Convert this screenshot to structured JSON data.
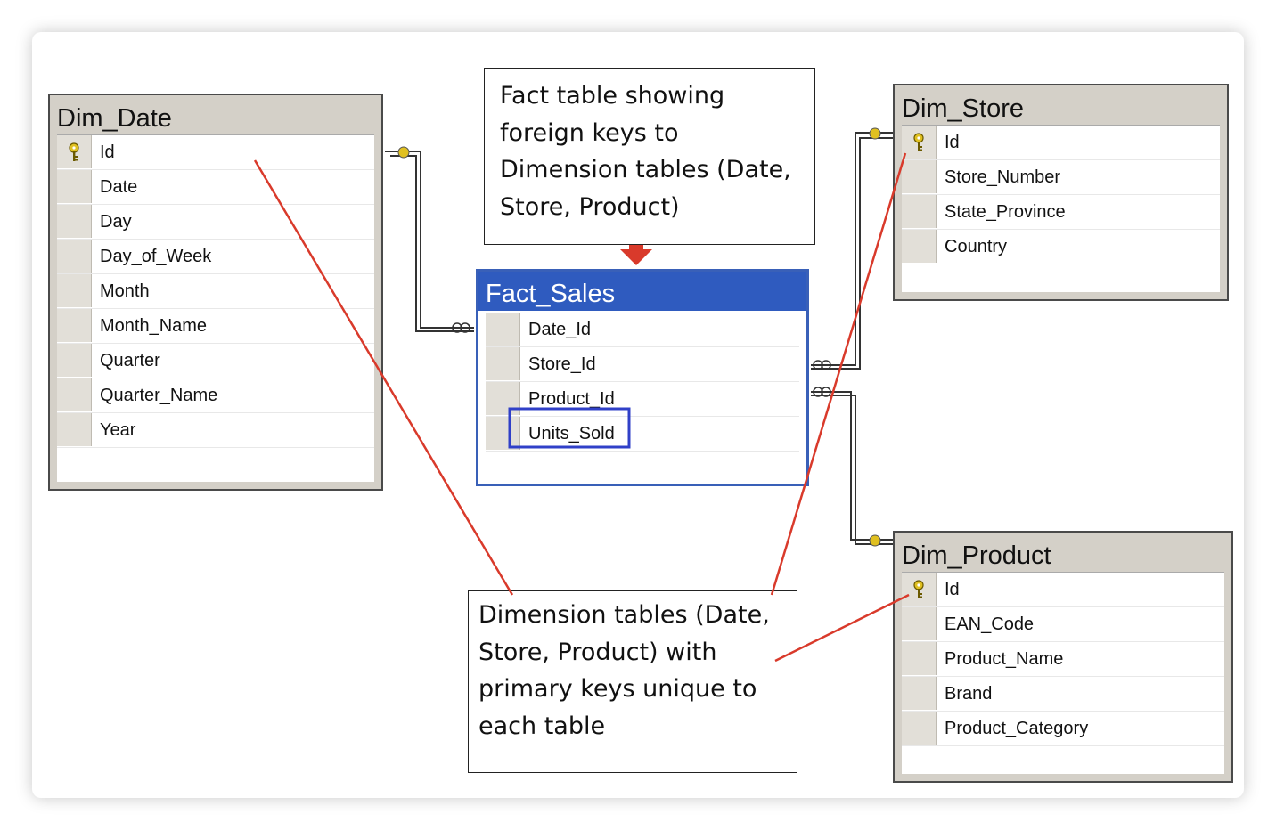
{
  "tables": {
    "dim_date": {
      "title": "Dim_Date",
      "fields": [
        {
          "name": "Id",
          "pk": true
        },
        {
          "name": "Date",
          "pk": false
        },
        {
          "name": "Day",
          "pk": false
        },
        {
          "name": "Day_of_Week",
          "pk": false
        },
        {
          "name": "Month",
          "pk": false
        },
        {
          "name": "Month_Name",
          "pk": false
        },
        {
          "name": "Quarter",
          "pk": false
        },
        {
          "name": "Quarter_Name",
          "pk": false
        },
        {
          "name": "Year",
          "pk": false
        }
      ]
    },
    "fact_sales": {
      "title": "Fact_Sales",
      "fields": [
        {
          "name": "Date_Id",
          "pk": false
        },
        {
          "name": "Store_Id",
          "pk": false
        },
        {
          "name": "Product_Id",
          "pk": false
        },
        {
          "name": "Units_Sold",
          "pk": false,
          "highlight": true
        }
      ]
    },
    "dim_store": {
      "title": "Dim_Store",
      "fields": [
        {
          "name": "Id",
          "pk": true
        },
        {
          "name": "Store_Number",
          "pk": false
        },
        {
          "name": "State_Province",
          "pk": false
        },
        {
          "name": "Country",
          "pk": false
        }
      ]
    },
    "dim_product": {
      "title": "Dim_Product",
      "fields": [
        {
          "name": "Id",
          "pk": true
        },
        {
          "name": "EAN_Code",
          "pk": false
        },
        {
          "name": "Product_Name",
          "pk": false
        },
        {
          "name": "Brand",
          "pk": false
        },
        {
          "name": "Product_Category",
          "pk": false
        }
      ]
    }
  },
  "notes": {
    "fact_note": [
      "Fact table showing",
      "foreign keys to",
      "Dimension tables (Date,",
      "Store, Product)"
    ],
    "dim_note": [
      "Dimension tables (Date,",
      "Store, Product) with",
      "primary keys unique to",
      "each table"
    ]
  },
  "colors": {
    "fact_header": "#2f5bbf",
    "annotation_line": "#d93a2b",
    "highlight_box": "#3040c8",
    "key_icon": "#e0c020"
  }
}
